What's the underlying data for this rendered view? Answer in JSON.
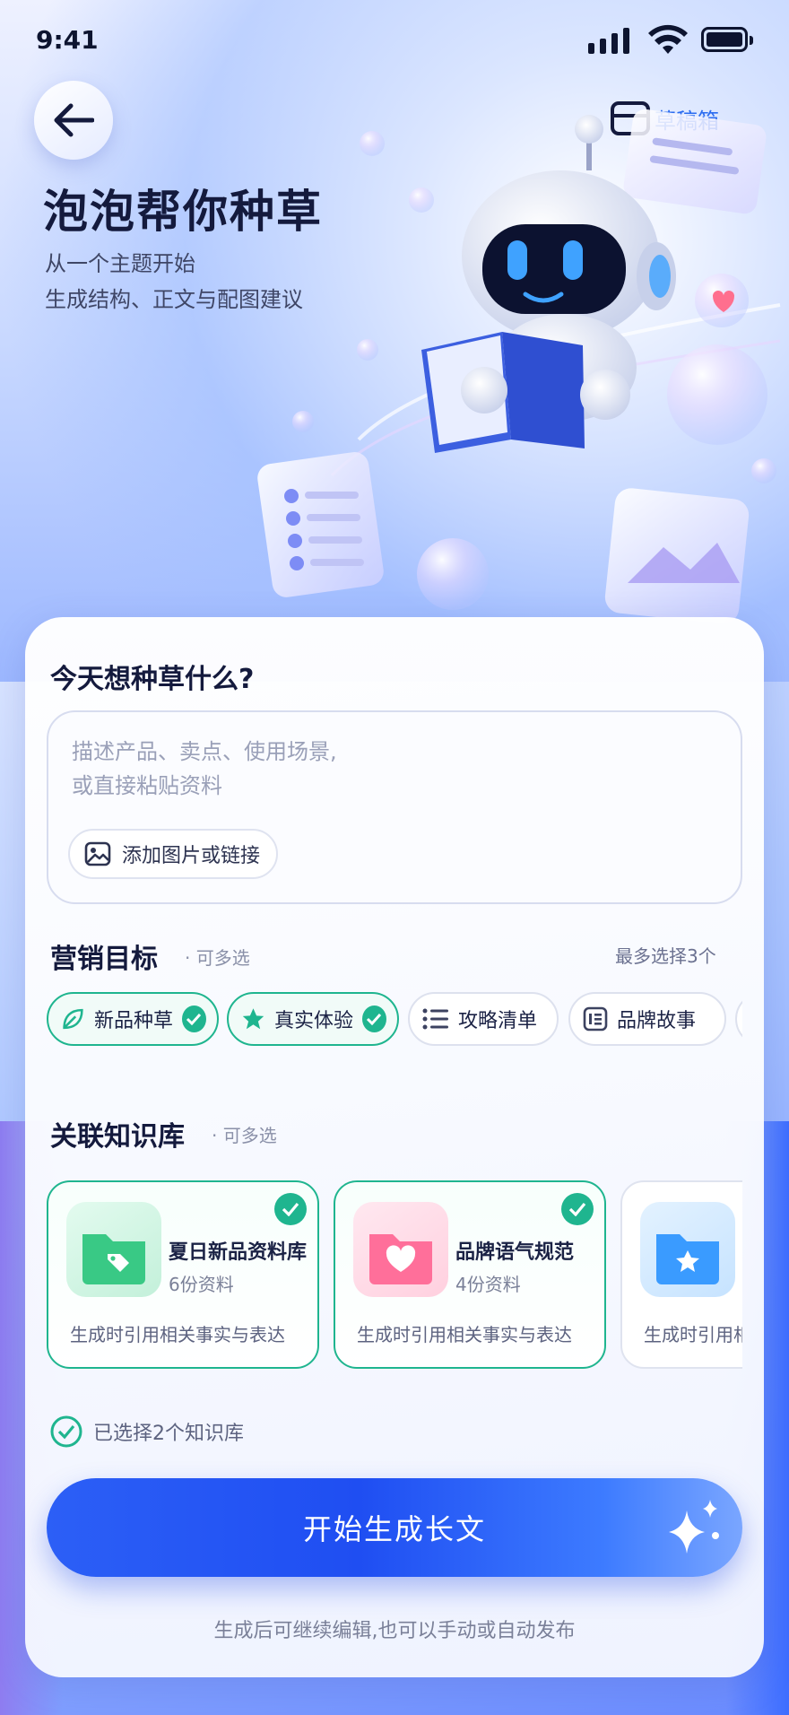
{
  "status_bar": {
    "time": "9:41"
  },
  "header": {
    "draft_label": "草稿箱",
    "title": "泡泡帮你种草",
    "subtitle_line1": "从一个主题开始",
    "subtitle_line2": "生成结构、正文与配图建议"
  },
  "prompt": {
    "question": "今天想种草什么?",
    "placeholder_line1": "描述产品、卖点、使用场景,",
    "placeholder_line2": "或直接粘贴资料",
    "attach_label": "添加图片或链接"
  },
  "goals": {
    "title": "营销目标",
    "hint": "· 可多选",
    "limit": "最多选择3个",
    "chips": [
      {
        "label": "新品种草",
        "selected": true,
        "icon": "leaf-icon"
      },
      {
        "label": "真实体验",
        "selected": true,
        "icon": "star-icon"
      },
      {
        "label": "攻略清单",
        "selected": false,
        "icon": "list-icon"
      },
      {
        "label": "品牌故事",
        "selected": false,
        "icon": "document-icon"
      }
    ]
  },
  "knowledge": {
    "title": "关联知识库",
    "hint": "· 可多选",
    "items": [
      {
        "name": "夏日新品资料库",
        "count": "6份资料",
        "desc": "生成时引用相关事实与表达",
        "selected": true,
        "color": "#3fd08e"
      },
      {
        "name": "品牌语气规范",
        "count": "4份资料",
        "desc": "生成时引用相关事实与表达",
        "selected": true,
        "color": "#ff6f9a"
      },
      {
        "name": "",
        "count": "",
        "desc": "生成时引用相",
        "selected": false,
        "color": "#3a9bff"
      }
    ],
    "selected_summary": "已选择2个知识库"
  },
  "cta": {
    "label": "开始生成长文"
  },
  "footer": {
    "note": "生成后可继续编辑,也可以手动或自动发布"
  }
}
